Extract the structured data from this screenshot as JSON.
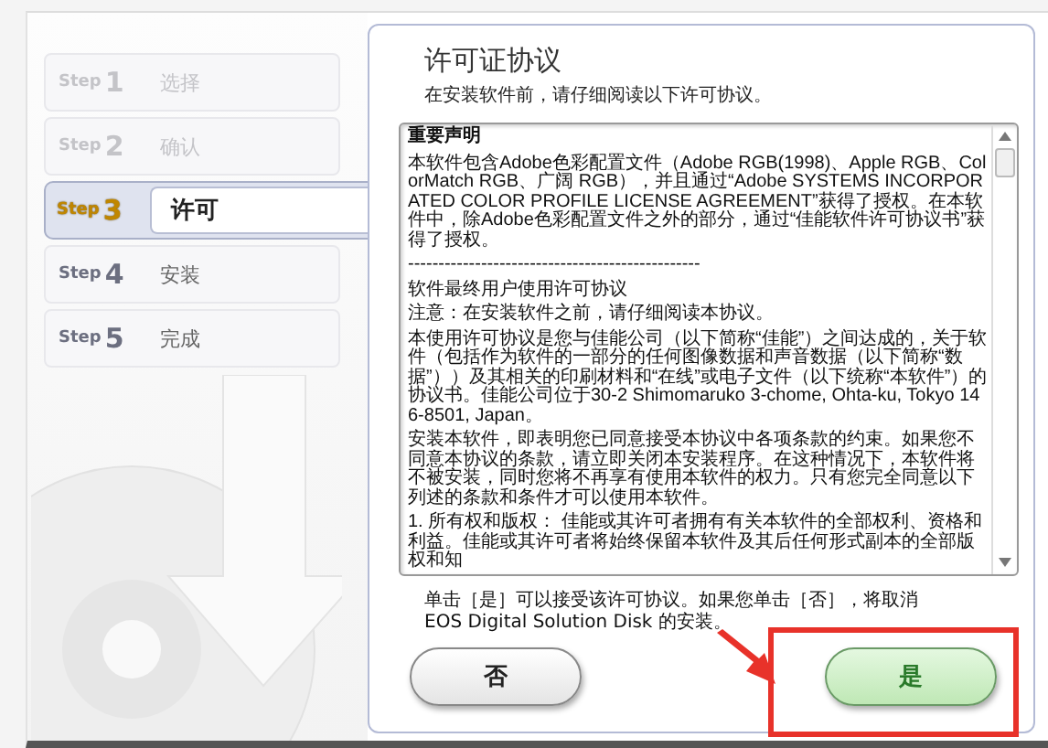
{
  "steps": [
    {
      "prefix": "Step",
      "number": "1",
      "label": "选择",
      "selected": false,
      "dimmed": true
    },
    {
      "prefix": "Step",
      "number": "2",
      "label": "确认",
      "selected": false,
      "dimmed": true
    },
    {
      "prefix": "Step",
      "number": "3",
      "label": "许可",
      "selected": true,
      "dimmed": false
    },
    {
      "prefix": "Step",
      "number": "4",
      "label": "安装",
      "selected": false,
      "dimmed": false
    },
    {
      "prefix": "Step",
      "number": "5",
      "label": "完成",
      "selected": false,
      "dimmed": false
    }
  ],
  "page": {
    "title": "许可证协议",
    "subtitle": "在安装软件前，请仔细阅读以下许可协议。"
  },
  "license": {
    "heading": "重要声明",
    "paragraphs": [
      "本软件包含Adobe色彩配置文件（Adobe RGB(1998)、Apple RGB、ColorMatch RGB、广阔 RGB），并且通过“Adobe SYSTEMS INCORPORATED COLOR PROFILE LICENSE AGREEMENT”获得了授权。在本软件中，除Adobe色彩配置文件之外的部分，通过“佳能软件许可协议书”获得了授权。",
      "------------------------------------------------",
      "软件最终用户使用许可协议",
      "注意：在安装软件之前，请仔细阅读本协议。",
      "本使用许可协议是您与佳能公司（以下简称“佳能”）之间达成的，关于软件（包括作为软件的一部分的任何图像数据和声音数据（以下简称“数据”））及其相关的印刷材料和“在线”或电子文件（以下统称“本软件”）的协议书。佳能公司位于30-2 Shimomaruko 3-chome, Ohta-ku, Tokyo 146-8501, Japan。",
      "安装本软件，即表明您已同意接受本协议中各项条款的约束。如果您不同意本协议的条款，请立即关闭本安装程序。在这种情况下，本软件将不被安装，同时您将不再享有使用本软件的权力。只有您完全同意以下列述的条款和条件才可以使用本软件。",
      "1. 所有权和版权： 佳能或其许可者拥有有关本软件的全部权利、资格和利益。佳能或其许可者将始终保留本软件及其后任何形式副本的全部版权和知"
    ]
  },
  "note": "单击［是］可以接受该许可协议。如果您单击［否］，将取消 EOS Digital Solution Disk 的安装。",
  "buttons": [
    {
      "label": "否",
      "kind": "normal"
    },
    {
      "label": "是",
      "kind": "primary"
    }
  ]
}
